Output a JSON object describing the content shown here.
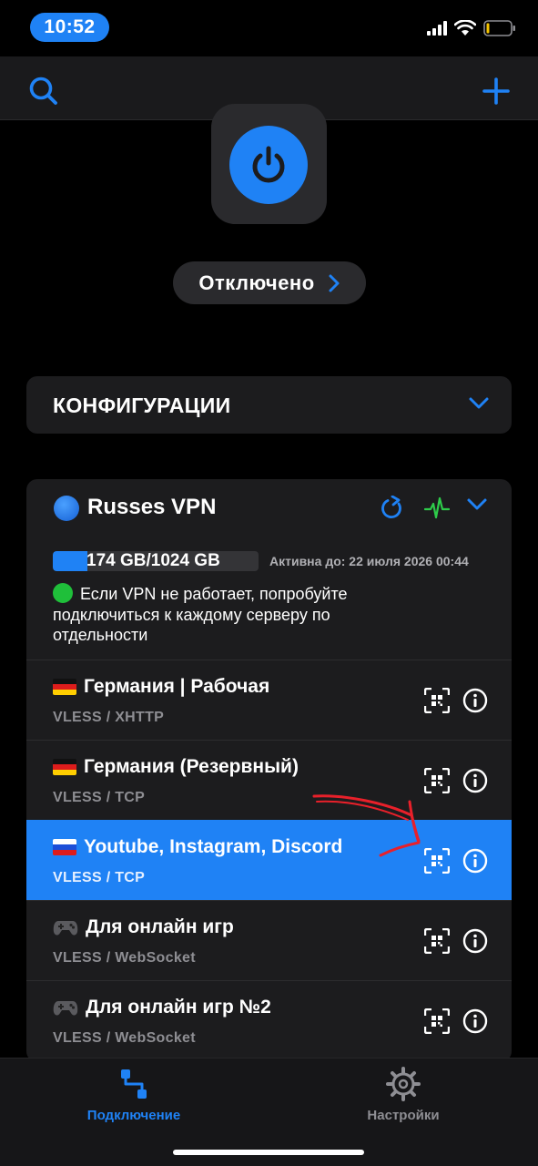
{
  "status_bar": {
    "time": "10:52"
  },
  "top_bar": {
    "search_icon": "search-icon",
    "add_icon": "plus-icon"
  },
  "power": {
    "state_label": "Отключено"
  },
  "configs": {
    "title": "КОНФИГУРАЦИИ"
  },
  "subscription": {
    "name": "Russes VPN",
    "traffic_text": "174 GB/1024 GB",
    "traffic_used_fraction": 0.17,
    "expires": "Активна до: 22 июля 2026 00:44",
    "notice": "Если VPN не работает, попробуйте подключиться к каждому серверу по отдельности"
  },
  "servers": [
    {
      "name": "Германия | Рабочая",
      "protocol": "VLESS / XHTTP",
      "flag": "de",
      "active": false
    },
    {
      "name": "Германия (Резервный)",
      "protocol": "VLESS / TCP",
      "flag": "de",
      "active": false
    },
    {
      "name": "Youtube, Instagram, Discord",
      "protocol": "VLESS / TCP",
      "flag": "ru",
      "active": true
    },
    {
      "name": "Для онлайн игр",
      "protocol": "VLESS / WebSocket",
      "flag": "gamepad",
      "active": false
    },
    {
      "name": "Для онлайн игр №2",
      "protocol": "VLESS / WebSocket",
      "flag": "gamepad",
      "active": false
    }
  ],
  "tabs": [
    {
      "label": "Подключение",
      "active": true
    },
    {
      "label": "Настройки",
      "active": false
    }
  ],
  "colors": {
    "accent": "#1f82f5",
    "background": "#000000",
    "card": "#1c1c1e",
    "pulse": "#2ecc4a"
  }
}
